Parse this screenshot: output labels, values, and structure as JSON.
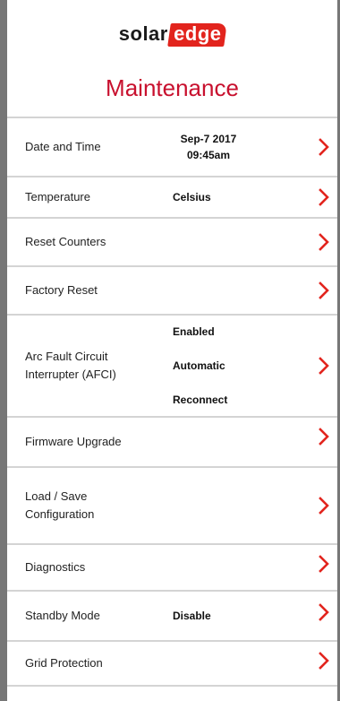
{
  "logo": {
    "solar": "solar",
    "edge": "edge"
  },
  "title": "Maintenance",
  "items": [
    {
      "label": "Date and Time",
      "value_lines": [
        "Sep-7 2017",
        "09:45am"
      ]
    },
    {
      "label": "Temperature",
      "value_lines": [
        "Celsius"
      ]
    },
    {
      "label": "Reset Counters",
      "value_lines": []
    },
    {
      "label": "Factory Reset",
      "value_lines": []
    },
    {
      "label": "Arc Fault Circuit Interrupter (AFCI)",
      "value_lines": [
        "Enabled",
        "Automatic",
        "Reconnect"
      ]
    },
    {
      "label": "Firmware Upgrade",
      "value_lines": []
    },
    {
      "label": "Load / Save Configuration",
      "value_lines": []
    },
    {
      "label": "Diagnostics",
      "value_lines": []
    },
    {
      "label": "Standby Mode",
      "value_lines": [
        "Disable"
      ]
    },
    {
      "label": "Grid Protection",
      "value_lines": []
    }
  ],
  "colors": {
    "accent": "#c8102e",
    "chevron": "#e2241d",
    "divider": "#d4d4d4"
  },
  "icons": {
    "chevron": "chevron-right-icon"
  }
}
